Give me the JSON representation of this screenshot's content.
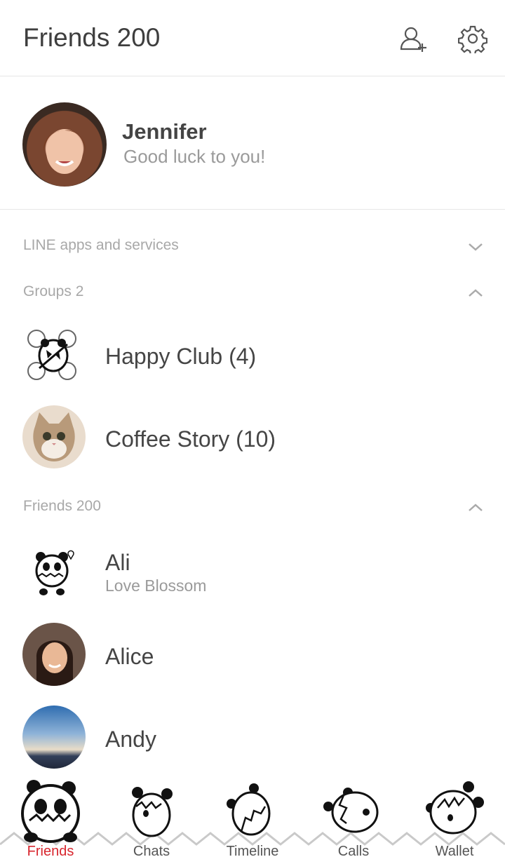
{
  "header": {
    "title": "Friends 200",
    "add_friend_icon": "add-friend-icon",
    "settings_icon": "gear-icon"
  },
  "profile": {
    "name": "Jennifer",
    "status": "Good luck to you!"
  },
  "sections": {
    "line_apps": "LINE apps and services",
    "groups": "Groups 2",
    "friends": "Friends 200"
  },
  "groups": [
    {
      "name": "Happy Club (4)"
    },
    {
      "name": "Coffee Story (10)"
    }
  ],
  "friends": [
    {
      "name": "Ali",
      "status": "Love Blossom"
    },
    {
      "name": "Alice"
    },
    {
      "name": "Andy"
    }
  ],
  "tabs": [
    {
      "label": "Friends",
      "active": true
    },
    {
      "label": "Chats"
    },
    {
      "label": "Timeline"
    },
    {
      "label": "Calls"
    },
    {
      "label": "Wallet"
    }
  ],
  "colors": {
    "active_tab": "#d8262e",
    "divider": "#e6e6e6",
    "section_text": "#a8a8a8"
  }
}
